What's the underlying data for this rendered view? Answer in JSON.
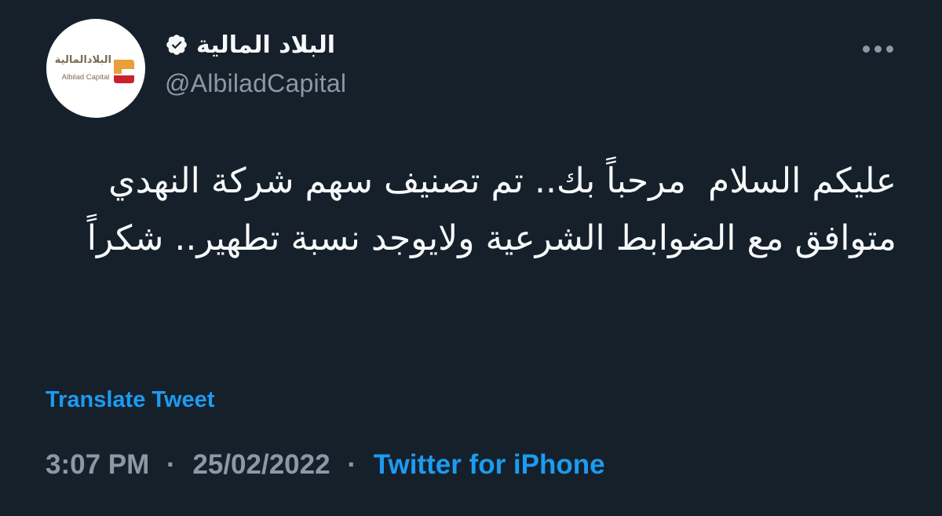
{
  "author": {
    "display_name": "البلاد المالية",
    "handle": "@AlbiladCapital",
    "verified": true,
    "avatar_logo_ar": "البلادالمالية",
    "avatar_logo_en": "Albilad Capital"
  },
  "tweet": {
    "text": "عليكم السلام  مرحباً بك.. تم تصنيف سهم شركة النهدي متوافق مع الضوابط الشرعية ولايوجد نسبة تطهير.. شكراً",
    "translate_label": "Translate Tweet",
    "time": "3:07 PM",
    "date": "25/02/2022",
    "separator": "·",
    "source": "Twitter for iPhone"
  },
  "icons": {
    "more": "more-horizontal-icon",
    "verified": "verified-badge-icon"
  },
  "colors": {
    "background": "#15202b",
    "text": "#f7f9f9",
    "muted": "#8b98a5",
    "link": "#1d9bf0",
    "logo_orange": "#e8a03a",
    "logo_red": "#c8222c"
  }
}
